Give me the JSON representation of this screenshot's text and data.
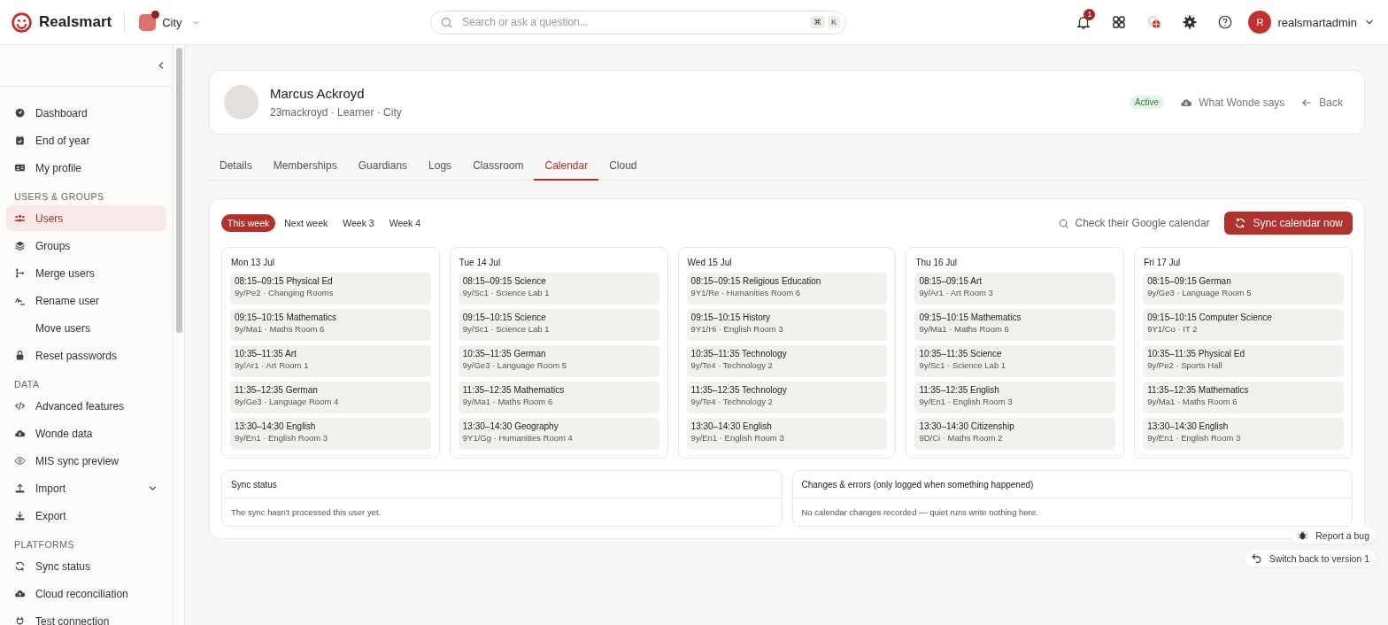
{
  "header": {
    "brand": "Realsmart",
    "school": "City",
    "search": {
      "placeholder": "Search or ask a question...",
      "keys": [
        "⌘",
        "K"
      ]
    },
    "notifications": "1",
    "user": {
      "initial": "R",
      "name": "realsmartadmin"
    }
  },
  "sidebar": {
    "items": [
      {
        "kind": "link",
        "label": "Dashboard",
        "selected": false
      },
      {
        "kind": "link",
        "label": "End of year",
        "selected": false
      },
      {
        "kind": "link",
        "label": "My profile",
        "selected": false
      },
      {
        "kind": "section",
        "label": "USERS & GROUPS"
      },
      {
        "kind": "link",
        "label": "Users",
        "selected": true
      },
      {
        "kind": "link",
        "label": "Groups",
        "selected": false
      },
      {
        "kind": "link",
        "label": "Merge users",
        "selected": false
      },
      {
        "kind": "link",
        "label": "Rename user",
        "selected": false
      },
      {
        "kind": "link",
        "label": "Move users",
        "selected": false
      },
      {
        "kind": "link",
        "label": "Reset passwords",
        "selected": false
      },
      {
        "kind": "section",
        "label": "DATA"
      },
      {
        "kind": "link",
        "label": "Advanced features",
        "selected": false
      },
      {
        "kind": "link",
        "label": "Wonde data",
        "selected": false
      },
      {
        "kind": "link",
        "label": "MIS sync preview",
        "selected": false
      },
      {
        "kind": "link",
        "label": "Import",
        "selected": false,
        "expanded": false
      },
      {
        "kind": "link",
        "label": "Export",
        "selected": false
      },
      {
        "kind": "section",
        "label": "PLATFORMS"
      },
      {
        "kind": "link",
        "label": "Sync status",
        "selected": false
      },
      {
        "kind": "link",
        "label": "Cloud reconciliation",
        "selected": false
      },
      {
        "kind": "link",
        "label": "Test connection",
        "selected": false
      }
    ]
  },
  "profile": {
    "name": "Marcus Ackroyd",
    "meta": "23mackroyd · Learner · City",
    "status": "Active",
    "wonde": "What Wonde says",
    "back": "Back"
  },
  "tabs": [
    {
      "label": "Details",
      "selected": false
    },
    {
      "label": "Memberships",
      "selected": false
    },
    {
      "label": "Guardians",
      "selected": false
    },
    {
      "label": "Logs",
      "selected": false
    },
    {
      "label": "Classroom",
      "selected": false
    },
    {
      "label": "Calendar",
      "selected": true
    },
    {
      "label": "Cloud",
      "selected": false
    }
  ],
  "weeks": [
    {
      "label": "This week",
      "selected": true
    },
    {
      "label": "Next week",
      "selected": false
    },
    {
      "label": "Week 3",
      "selected": false
    },
    {
      "label": "Week 4",
      "selected": false
    }
  ],
  "google_check": "Check their Google calendar",
  "sync_button": "Sync calendar now",
  "days": [
    {
      "date": "Mon 13 Jul",
      "events": [
        {
          "title": "08:15–09:15 Physical Ed",
          "detail": "9y/Pe2 · Changing Rooms"
        },
        {
          "title": "09:15–10:15 Mathematics",
          "detail": "9y/Ma1 · Maths Room 6"
        },
        {
          "title": "10:35–11:35 Art",
          "detail": "9y/Ar1 · Art Room 1"
        },
        {
          "title": "11:35–12:35 German",
          "detail": "9y/Ge3 · Language Room 4"
        },
        {
          "title": "13:30–14:30 English",
          "detail": "9y/En1 · English Room 3"
        }
      ]
    },
    {
      "date": "Tue 14 Jul",
      "events": [
        {
          "title": "08:15–09:15 Science",
          "detail": "9y/Sc1 · Science Lab 1"
        },
        {
          "title": "09:15–10:15 Science",
          "detail": "9y/Sc1 · Science Lab 1"
        },
        {
          "title": "10:35–11:35 German",
          "detail": "9y/Ge3 · Language Room 5"
        },
        {
          "title": "11:35–12:35 Mathematics",
          "detail": "9y/Ma1 · Maths Room 6"
        },
        {
          "title": "13:30–14:30 Geography",
          "detail": "9Y1/Gg · Humanities Room 4"
        }
      ]
    },
    {
      "date": "Wed 15 Jul",
      "events": [
        {
          "title": "08:15–09:15 Religious Education",
          "detail": "9Y1/Re · Humanities Room 6"
        },
        {
          "title": "09:15–10:15 History",
          "detail": "9Y1/Hi · English Room 3"
        },
        {
          "title": "10:35–11:35 Technology",
          "detail": "9y/Te4 · Technology 2"
        },
        {
          "title": "11:35–12:35 Technology",
          "detail": "9y/Te4 · Technology 2"
        },
        {
          "title": "13:30–14:30 English",
          "detail": "9y/En1 · English Room 3"
        }
      ]
    },
    {
      "date": "Thu 16 Jul",
      "events": [
        {
          "title": "08:15–09:15 Art",
          "detail": "9y/Ar1 · Art Room 3"
        },
        {
          "title": "09:15–10:15 Mathematics",
          "detail": "9y/Ma1 · Maths Room 6"
        },
        {
          "title": "10:35–11:35 Science",
          "detail": "9y/Sc1 · Science Lab 1"
        },
        {
          "title": "11:35–12:35 English",
          "detail": "9y/En1 · English Room 3"
        },
        {
          "title": "13:30–14:30 Citizenship",
          "detail": "9D/Ci · Maths Room 2"
        }
      ]
    },
    {
      "date": "Fri 17 Jul",
      "events": [
        {
          "title": "08:15–09:15 German",
          "detail": "9y/Ge3 · Language Room 5"
        },
        {
          "title": "09:15–10:15 Computer Science",
          "detail": "9Y1/Co · IT 2"
        },
        {
          "title": "10:35–11:35 Physical Ed",
          "detail": "9y/Pe2 · Sports Hall"
        },
        {
          "title": "11:35–12:35 Mathematics",
          "detail": "9y/Ma1 · Maths Room 6"
        },
        {
          "title": "13:30–14:30 English",
          "detail": "9y/En1 · English Room 3"
        }
      ]
    }
  ],
  "panels": [
    {
      "title": "Sync status",
      "body": "The sync hasn't processed this user yet."
    },
    {
      "title": "Changes & errors (only logged when something happened)",
      "body": "No calendar changes recorded — quiet runs write nothing here."
    }
  ],
  "floating": {
    "report": "Report a bug",
    "switch_back": "Switch back to version 1"
  }
}
